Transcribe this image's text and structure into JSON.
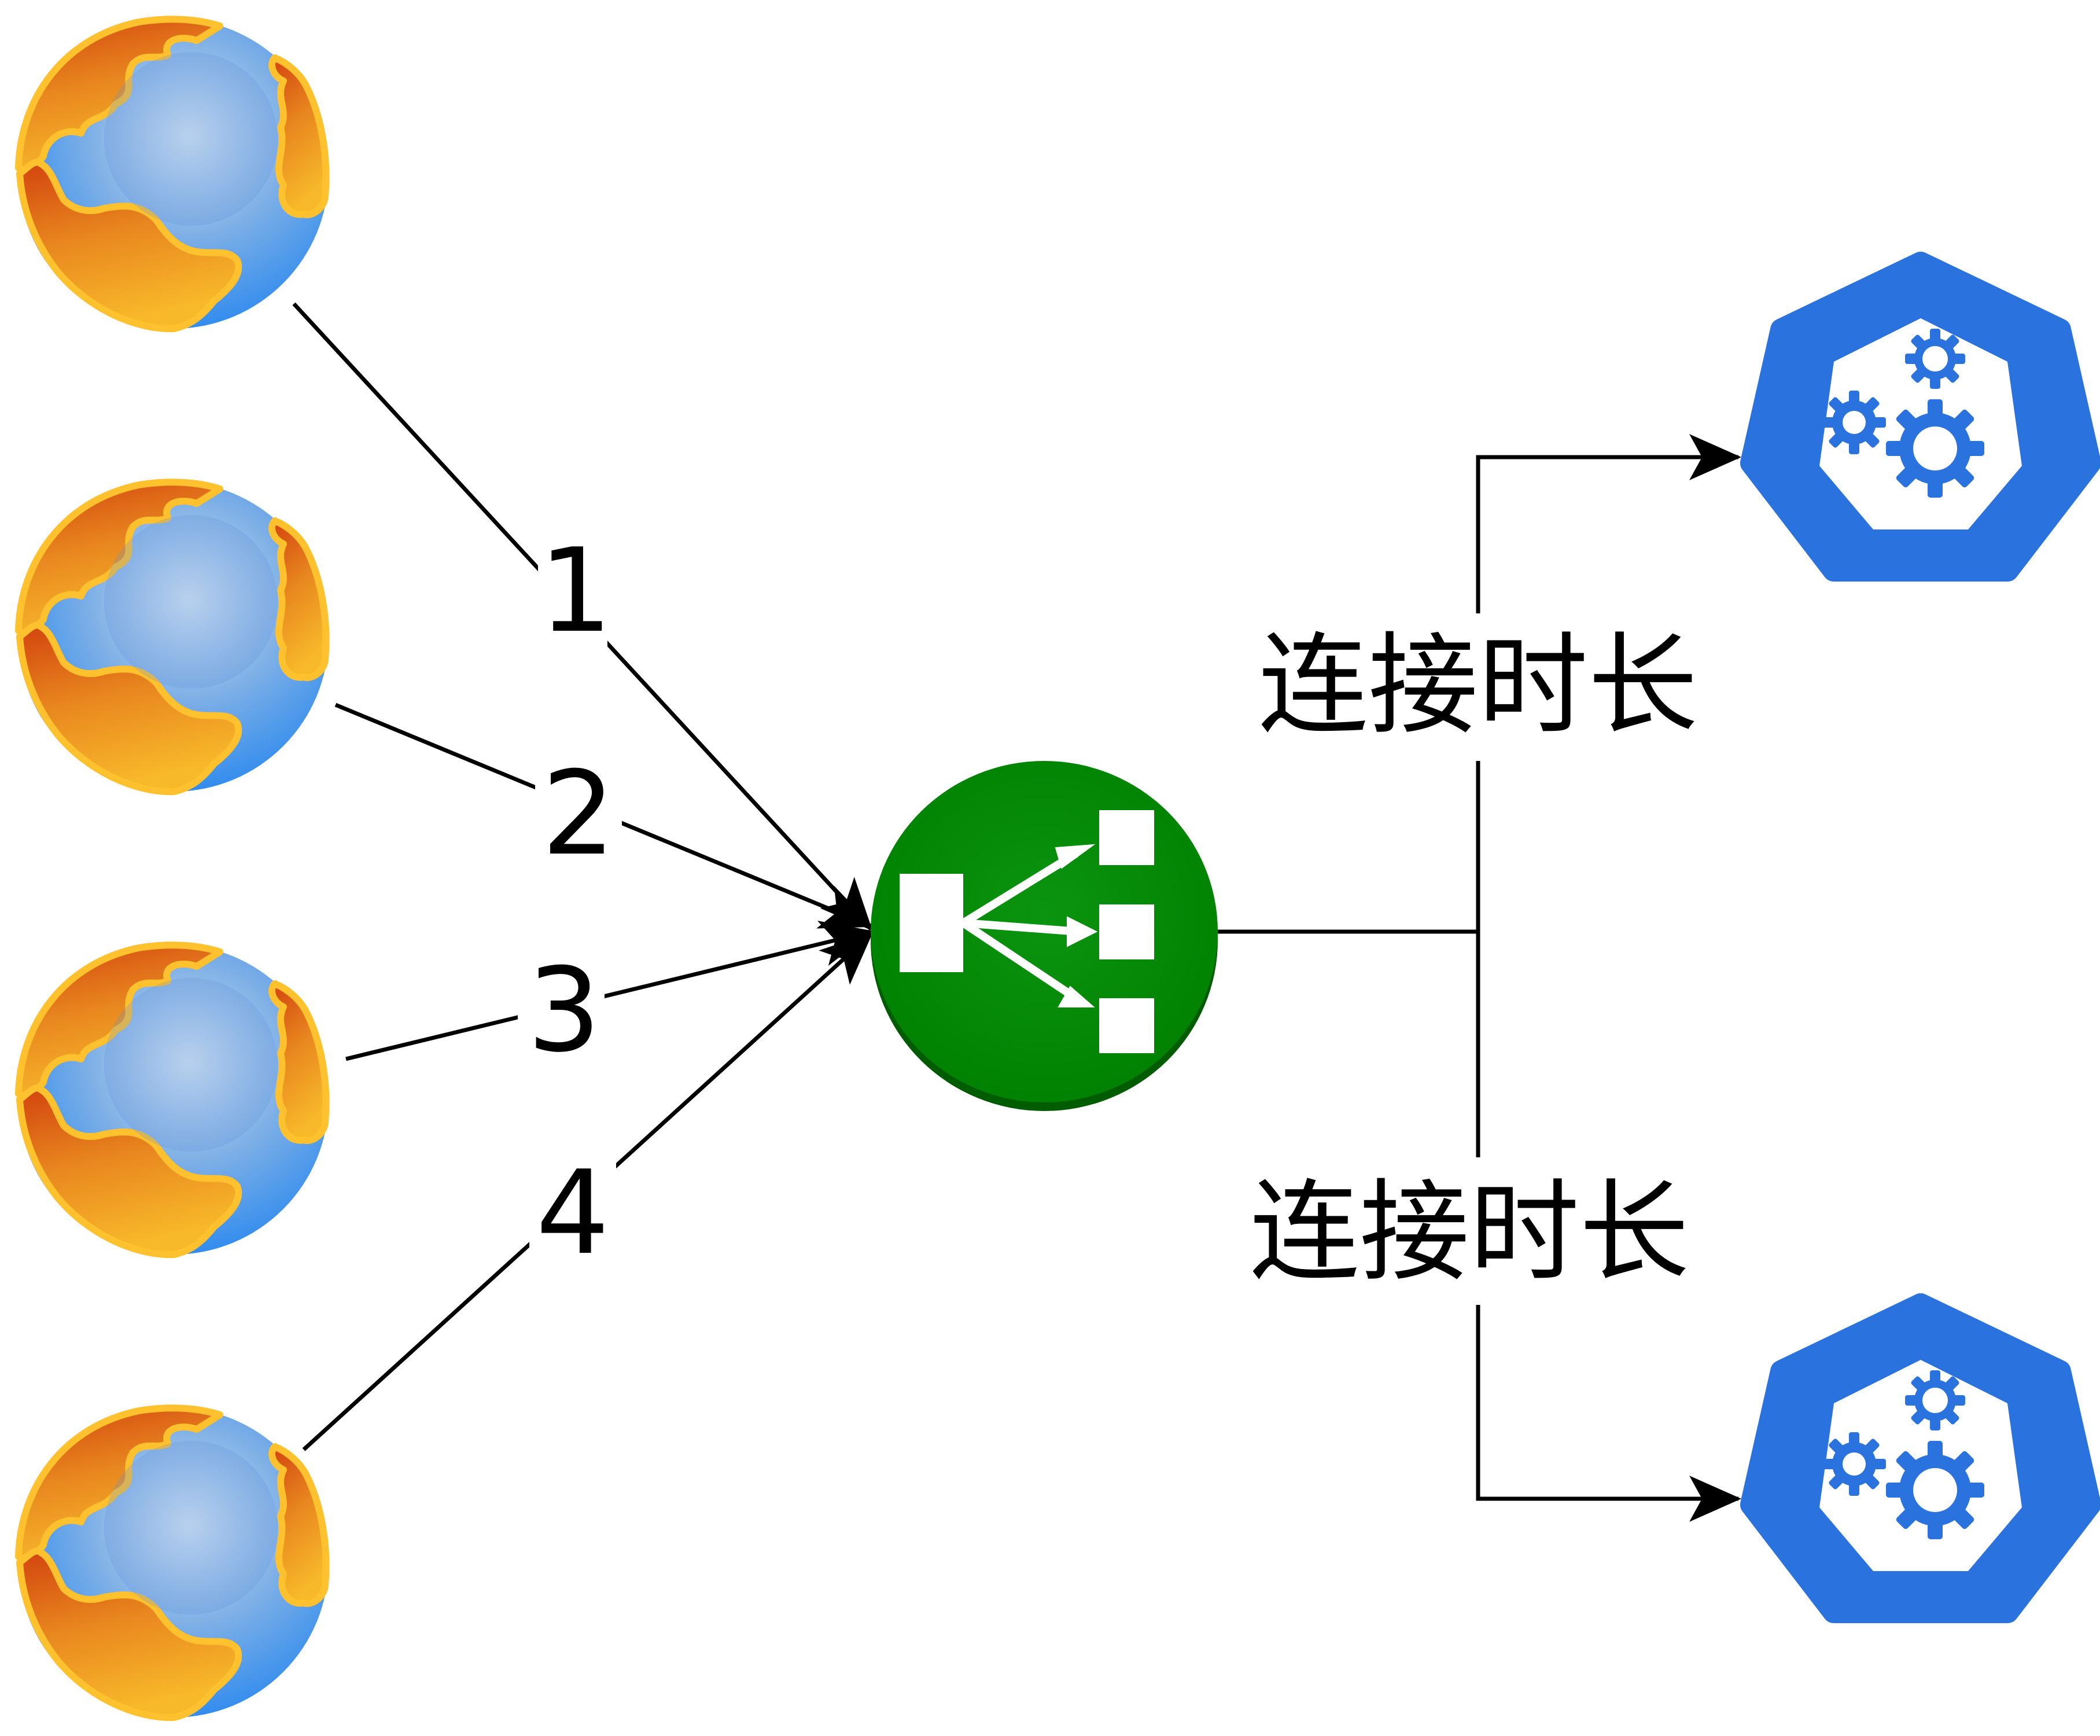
{
  "edges": {
    "client1": "1",
    "client2": "2",
    "client3": "3",
    "client4": "4",
    "upper_service": "连接时长",
    "lower_service": "连接时长"
  },
  "colors": {
    "line": "#000000",
    "load_balancer": "#008a00",
    "load_balancer_shadow": "#005c00",
    "service_hex": "#2a72de",
    "globe_ocean": "#5aa6ee",
    "globe_land": "#f0a02a",
    "globe_outline": "#ffc12e"
  },
  "icons": {
    "clients": "globe-icon",
    "balancer": "load-balancer-icon",
    "services": "kubernetes-service-icon"
  }
}
